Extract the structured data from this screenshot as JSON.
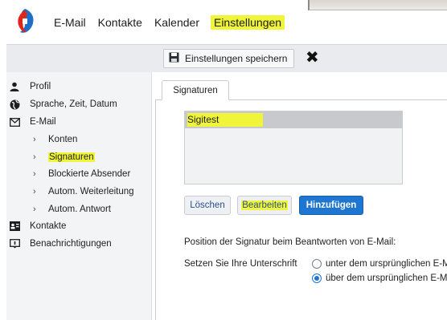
{
  "nav": {
    "items": [
      {
        "label": "E-Mail"
      },
      {
        "label": "Kontakte"
      },
      {
        "label": "Kalender"
      },
      {
        "label": "Einstellungen",
        "active": true
      }
    ]
  },
  "toolbar": {
    "save_label": "Einstellungen speichern",
    "save_icon": "floppy-disk-icon",
    "close_icon": "close-x-icon"
  },
  "sidebar": {
    "items": [
      {
        "label": "Profil",
        "icon": "person-icon"
      },
      {
        "label": "Sprache, Zeit, Datum",
        "icon": "globe-icon"
      },
      {
        "label": "E-Mail",
        "icon": "envelope-icon"
      },
      {
        "label": "Konten",
        "sub": true
      },
      {
        "label": "Signaturen",
        "sub": true,
        "selected": true
      },
      {
        "label": "Blockierte Absender",
        "sub": true
      },
      {
        "label": "Autom. Weiterleitung",
        "sub": true
      },
      {
        "label": "Autom. Antwort",
        "sub": true
      },
      {
        "label": "Kontakte",
        "icon": "contacts-card-icon"
      },
      {
        "label": "Benachrichtigungen",
        "icon": "notification-icon"
      }
    ]
  },
  "main": {
    "tab_label": "Signaturen",
    "signatures": [
      "Sigitest"
    ],
    "buttons": {
      "delete": "Löschen",
      "edit": "Bearbeiten",
      "add": "Hinzufügen"
    },
    "position_label": "Position der Signatur beim Beantworten von E-Mail:",
    "signature_label": "Setzen Sie Ihre Unterschrift",
    "radio_options": [
      {
        "label": "unter dem ursprünglichen E-M",
        "checked": false
      },
      {
        "label": "über dem ursprünglichen E-Ma",
        "checked": true
      }
    ]
  },
  "colors": {
    "accent": "#1f76d1",
    "highlight": "#f0f53a",
    "logo_red": "#e1251b",
    "logo_blue": "#1d6fc7"
  }
}
